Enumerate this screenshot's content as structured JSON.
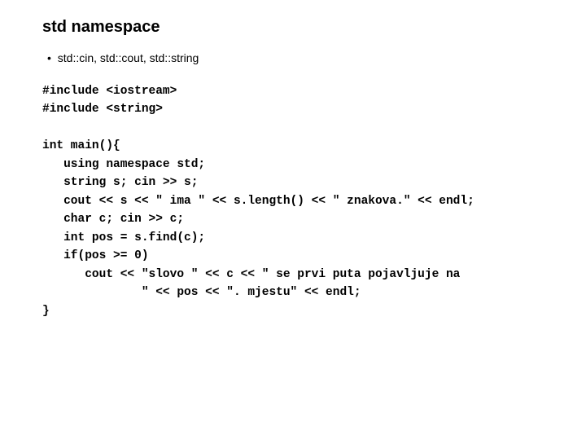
{
  "title": "std namespace",
  "bullet": "std::cin, std::cout, std::string",
  "code_lines": [
    "#include <iostream>",
    "#include <string>",
    "",
    "int main(){",
    "   using namespace std;",
    "   string s; cin >> s;",
    "   cout << s << \" ima \" << s.length() << \" znakova.\" << endl;",
    "   char c; cin >> c;",
    "   int pos = s.find(c);",
    "   if(pos >= 0)",
    "      cout << \"slovo \" << c << \" se prvi puta pojavljuje na",
    "              \" << pos << \". mjestu\" << endl;",
    "}"
  ]
}
